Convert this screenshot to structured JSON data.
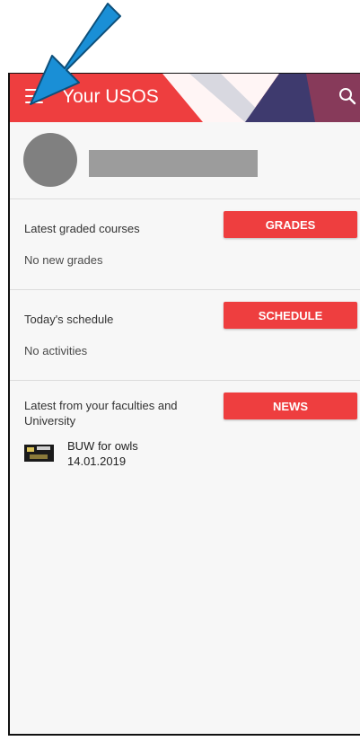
{
  "app_bar": {
    "title": "Your USOS",
    "menu_icon": "hamburger-menu-icon",
    "search_icon": "search-icon",
    "color": "#ee3e3f"
  },
  "profile": {
    "avatar": "avatar-placeholder",
    "name_redacted": true
  },
  "sections": {
    "grades": {
      "label": "Latest graded courses",
      "button": "GRADES",
      "empty": "No new grades"
    },
    "schedule": {
      "label": "Today's schedule",
      "button": "SCHEDULE",
      "empty": "No activities"
    },
    "news": {
      "label": "Latest from your faculties and University",
      "button": "NEWS",
      "items": [
        {
          "title": "BUW for owls",
          "date": "14.01.2019"
        }
      ]
    }
  },
  "annotation": {
    "arrow_color": "#1a8fd6",
    "points_to": "hamburger-menu-icon"
  }
}
